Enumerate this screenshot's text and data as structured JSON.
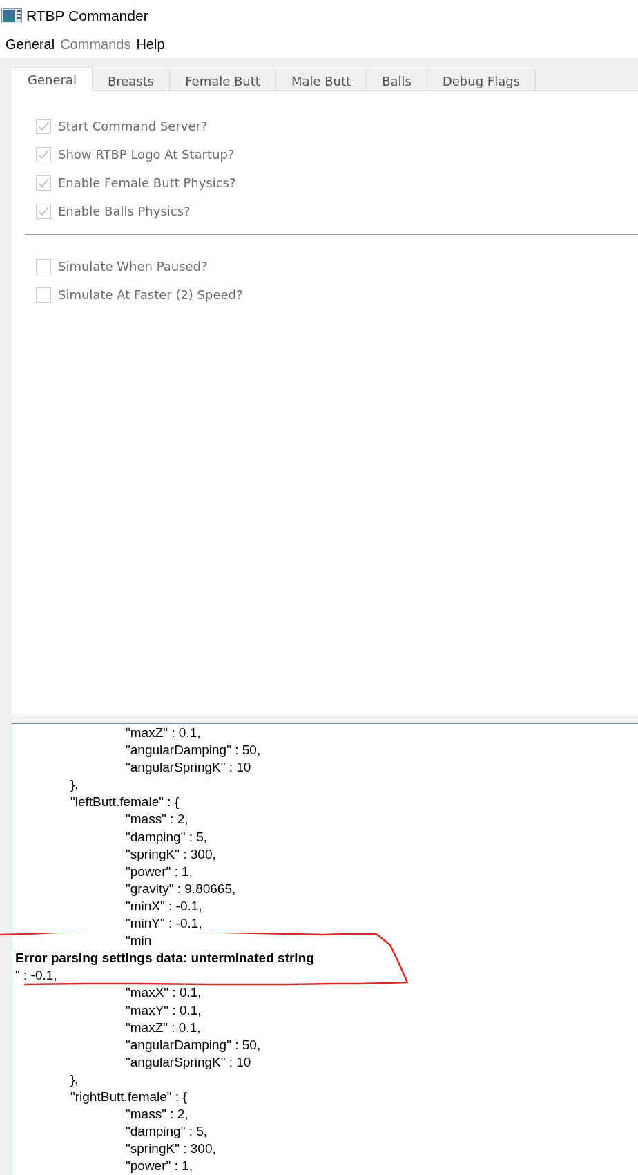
{
  "window": {
    "title": "RTBP Commander"
  },
  "menu": [
    {
      "label": "General",
      "disabled": false
    },
    {
      "label": "Commands",
      "disabled": true
    },
    {
      "label": "Help",
      "disabled": false
    }
  ],
  "tabs": [
    {
      "label": "General",
      "selected": true
    },
    {
      "label": "Breasts",
      "selected": false
    },
    {
      "label": "Female Butt",
      "selected": false
    },
    {
      "label": "Male Butt",
      "selected": false
    },
    {
      "label": "Balls",
      "selected": false
    },
    {
      "label": "Debug Flags",
      "selected": false
    }
  ],
  "option_groups": [
    [
      {
        "label": "Start Command Server?",
        "checked": true
      },
      {
        "label": "Show RTBP Logo At Startup?",
        "checked": true
      },
      {
        "label": "Enable Female Butt Physics?",
        "checked": true
      },
      {
        "label": "Enable Balls Physics?",
        "checked": true
      }
    ],
    [
      {
        "label": "Simulate When Paused?",
        "checked": false
      },
      {
        "label": "Simulate At Faster (2) Speed?",
        "checked": false
      }
    ]
  ],
  "log": [
    {
      "kind": "text",
      "text": "\t\t\"maxZ\" : 0.1,"
    },
    {
      "kind": "text",
      "text": "\t\t\"angularDamping\" : 50,"
    },
    {
      "kind": "text",
      "text": "\t\t\"angularSpringK\" : 10"
    },
    {
      "kind": "text",
      "text": "\t},"
    },
    {
      "kind": "text",
      "text": "\t\"leftButt.female\" : {"
    },
    {
      "kind": "text",
      "text": "\t\t\"mass\" : 2,"
    },
    {
      "kind": "text",
      "text": "\t\t\"damping\" : 5,"
    },
    {
      "kind": "text",
      "text": "\t\t\"springK\" : 300,"
    },
    {
      "kind": "text",
      "text": "\t\t\"power\" : 1,"
    },
    {
      "kind": "text",
      "text": "\t\t\"gravity\" : 9.80665,"
    },
    {
      "kind": "text",
      "text": "\t\t\"minX\" : -0.1,"
    },
    {
      "kind": "text",
      "text": "\t\t\"minY\" : -0.1,"
    },
    {
      "kind": "text",
      "text": "\t\t\"min"
    },
    {
      "kind": "error",
      "text": "Error parsing settings data: unterminated string"
    },
    {
      "kind": "text",
      "text": "\" : -0.1,"
    },
    {
      "kind": "text",
      "text": "\t\t\"maxX\" : 0.1,"
    },
    {
      "kind": "text",
      "text": "\t\t\"maxY\" : 0.1,"
    },
    {
      "kind": "text",
      "text": "\t\t\"maxZ\" : 0.1,"
    },
    {
      "kind": "text",
      "text": "\t\t\"angularDamping\" : 50,"
    },
    {
      "kind": "text",
      "text": "\t\t\"angularSpringK\" : 10"
    },
    {
      "kind": "text",
      "text": "\t},"
    },
    {
      "kind": "text",
      "text": "\t\"rightButt.female\" : {"
    },
    {
      "kind": "text",
      "text": "\t\t\"mass\" : 2,"
    },
    {
      "kind": "text",
      "text": "\t\t\"damping\" : 5,"
    },
    {
      "kind": "text",
      "text": "\t\t\"springK\" : 300,"
    },
    {
      "kind": "text",
      "text": "\t\t\"power\" : 1,"
    }
  ]
}
